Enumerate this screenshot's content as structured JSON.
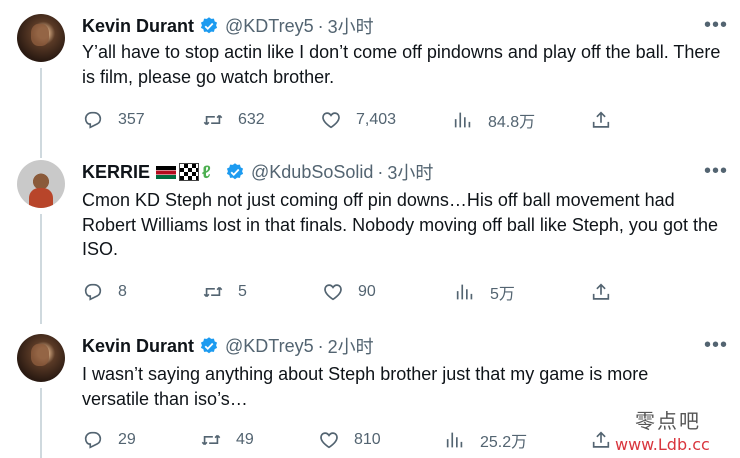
{
  "tweets": [
    {
      "name": "Kevin Durant",
      "handle": "@KDTrey5",
      "time": "3小时",
      "text": "Y’all have to stop actin like I don’t come off pindowns and play off the ball. There is film, please go watch brother.",
      "replies": "357",
      "retweets": "632",
      "likes": "7,403",
      "views": "84.8万"
    },
    {
      "name": "KERRIE",
      "handle": "@KdubSoSolid",
      "time": "3小时",
      "text": "Cmon KD Steph not just coming off pin downs…His off ball movement had Robert Williams lost in that finals. Nobody moving off ball like Steph, you got the ISO.",
      "replies": "8",
      "retweets": "5",
      "likes": "90",
      "views": "5万"
    },
    {
      "name": "Kevin Durant",
      "handle": "@KDTrey5",
      "time": "2小时",
      "text": "I wasn’t saying anything about Steph brother just that my game is more versatile than iso’s…",
      "replies": "29",
      "retweets": "49",
      "likes": "810",
      "views": "25.2万"
    }
  ],
  "dot_separator": "·",
  "watermark": {
    "cn": "零点吧",
    "url": "www.Ldb.cc"
  },
  "colors": {
    "verified": "#1d9bf0",
    "secondary_text": "#536471",
    "thread_line": "#cfd9de"
  }
}
